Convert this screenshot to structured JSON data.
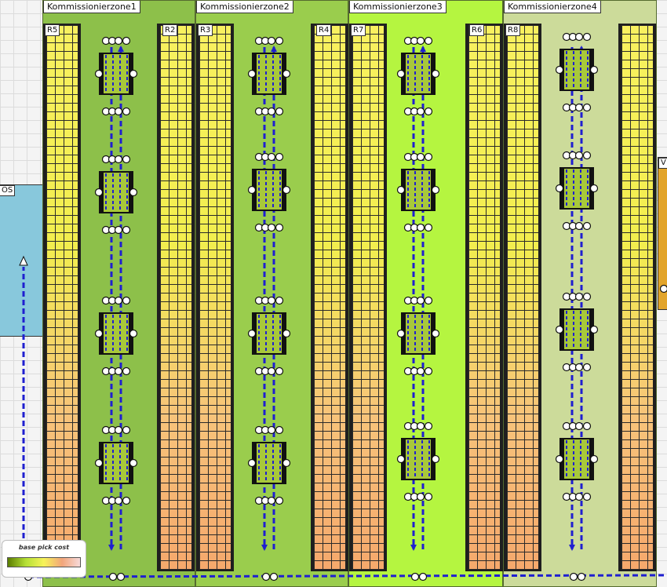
{
  "zones": [
    {
      "title": "Kommissionierzone1",
      "color": "#8dc04a"
    },
    {
      "title": "Kommissionierzone2",
      "color": "#9acd4d"
    },
    {
      "title": "Kommissionierzone3",
      "color": "#b5f540"
    },
    {
      "title": "Kommissionierzone4",
      "color": "#ccdb9a"
    }
  ],
  "racks": [
    {
      "label": "R5"
    },
    {
      "label": "R2"
    },
    {
      "label": "R3"
    },
    {
      "label": "R4"
    },
    {
      "label": "R7"
    },
    {
      "label": "R6"
    },
    {
      "label": "R8"
    },
    {
      "label": ""
    }
  ],
  "stations": {
    "left": {
      "label": "OS",
      "color": "#88c8dc"
    },
    "right": {
      "label": "V",
      "color": "#e2a42a"
    }
  },
  "legend": {
    "title": "base pick cost"
  },
  "colors": {
    "flow": "#1f1fd0",
    "rack_frame": "#1f1f1f"
  }
}
